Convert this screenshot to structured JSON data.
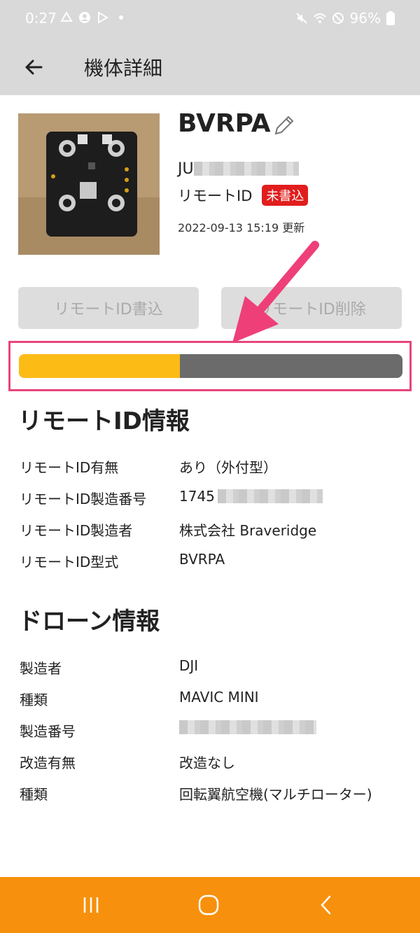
{
  "status_bar": {
    "time": "0:27",
    "battery": "96%"
  },
  "app_bar": {
    "title": "機体詳細",
    "back_icon": "arrow-left-icon"
  },
  "aircraft": {
    "name": "BVRPA",
    "registration_prefix": "JU",
    "remote_id_label": "リモートID",
    "remote_id_status": "未書込",
    "updated": "2022-09-13 15:19 更新"
  },
  "actions": {
    "write_label": "リモートID書込",
    "delete_label": "リモートID削除"
  },
  "progress": {
    "fraction": 0.42
  },
  "remote_id_section": {
    "title": "リモートID情報",
    "rows": [
      {
        "label": "リモートID有無",
        "value": "あり（外付型）"
      },
      {
        "label": "リモートID製造番号",
        "value": "1745"
      },
      {
        "label": "リモートID製造者",
        "value": "株式会社 Braveridge"
      },
      {
        "label": "リモートID型式",
        "value": "BVRPA"
      }
    ]
  },
  "drone_section": {
    "title": "ドローン情報",
    "rows": [
      {
        "label": "製造者",
        "value": "DJI"
      },
      {
        "label": "種類",
        "value": "MAVIC MINI"
      },
      {
        "label": "製造番号",
        "value": ""
      },
      {
        "label": "改造有無",
        "value": "改造なし"
      },
      {
        "label": "種類",
        "value": "回転翼航空機(マルチローター)"
      }
    ]
  },
  "colors": {
    "accent": "#f7900d",
    "progress_fill": "#fdbb16",
    "badge": "#e11d1d",
    "highlight": "#e8457c"
  }
}
